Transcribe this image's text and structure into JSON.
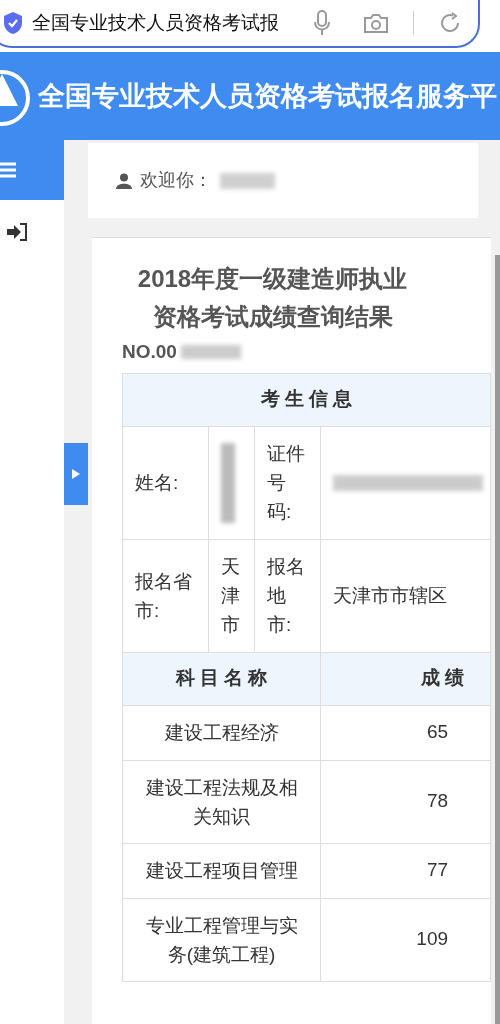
{
  "address_bar": {
    "query": "全国专业技术人员资格考试报"
  },
  "header": {
    "title": "全国专业技术人员资格考试报名服务平"
  },
  "welcome": {
    "label": "欢迎你："
  },
  "result": {
    "title": "2018年度一级建造师执业资格考试成绩查询结果",
    "number": "NO.00"
  },
  "candidate_info": {
    "heading": "考 生 信 息",
    "rows": [
      {
        "cells": [
          {
            "kind": "label",
            "text": "姓名:"
          },
          {
            "kind": "redacted"
          },
          {
            "kind": "label",
            "text": "证件号码:"
          },
          {
            "kind": "redacted"
          }
        ]
      },
      {
        "cells": [
          {
            "kind": "label",
            "text": "报名省市:"
          },
          {
            "kind": "value",
            "text": "天津市"
          },
          {
            "kind": "label",
            "text": "报名地市:"
          },
          {
            "kind": "value",
            "text": "天津市市辖区"
          }
        ]
      }
    ]
  },
  "scores": {
    "columns": [
      "科 目 名 称",
      "成 绩"
    ],
    "rows": [
      {
        "subject": "建设工程经济",
        "score": "65"
      },
      {
        "subject": "建设工程法规及相关知识",
        "score": "78"
      },
      {
        "subject": "建设工程项目管理",
        "score": "77"
      },
      {
        "subject": "专业工程管理与实务(建筑工程)",
        "score": "109"
      }
    ]
  }
}
